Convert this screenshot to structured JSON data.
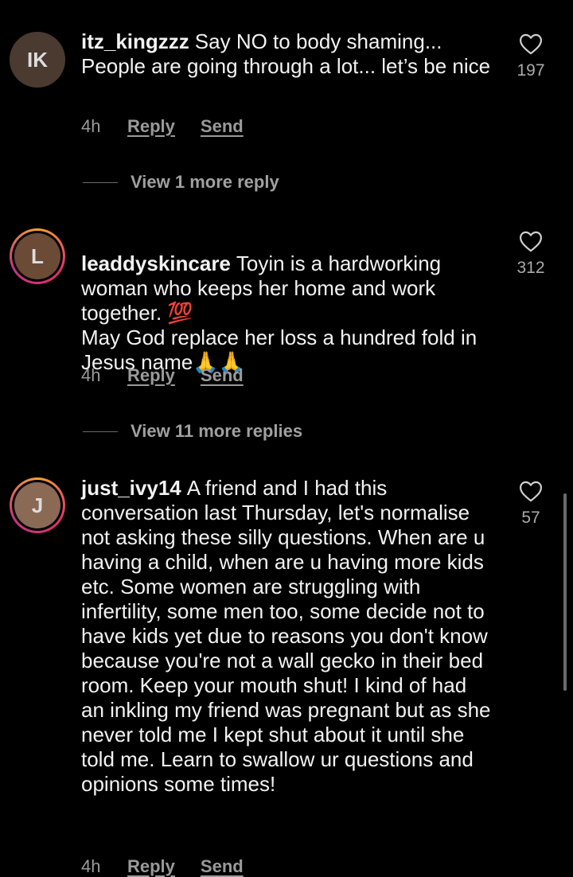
{
  "comments": [
    {
      "username": "itz_kingzzz",
      "text": "Say NO to body shaming... People are going through a lot... let’s be nice",
      "time": "4h",
      "reply_label": "Reply",
      "send_label": "Send",
      "likes": "197",
      "avatar_initials": "IK",
      "avatar_color": "#5b4a3d"
    },
    {
      "username": "leaddyskincare",
      "text": "Toyin is a hardworking woman who keeps her home and work together. 💯\nMay God replace her loss a hundred fold in Jesus name🙏🙏",
      "time": "4h",
      "reply_label": "Reply",
      "send_label": "Send",
      "likes": "312",
      "avatar_initials": "L",
      "avatar_color": "#7a5a44"
    },
    {
      "username": "just_ivy14",
      "text": "A friend and I had this conversation last Thursday,  let's normalise not asking these silly questions.  When are u having a child, when are u having more kids etc. Some women are struggling with infertility, some men too, some decide not to have kids yet due to reasons you don't know because you're not a wall gecko in their bed room. Keep your mouth shut!  I kind of had an inkling my friend was pregnant but as she never told me I kept shut about it until she told me. Learn to swallow ur questions and opinions some times!",
      "time": "4h",
      "reply_label": "Reply",
      "send_label": "Send",
      "likes": "57",
      "avatar_initials": "J",
      "avatar_color": "#8a6a55"
    }
  ],
  "view_replies": [
    {
      "label": "View 1 more reply"
    },
    {
      "label": "View 11 more replies"
    }
  ],
  "icons": {
    "like": "heart-outline-icon"
  }
}
